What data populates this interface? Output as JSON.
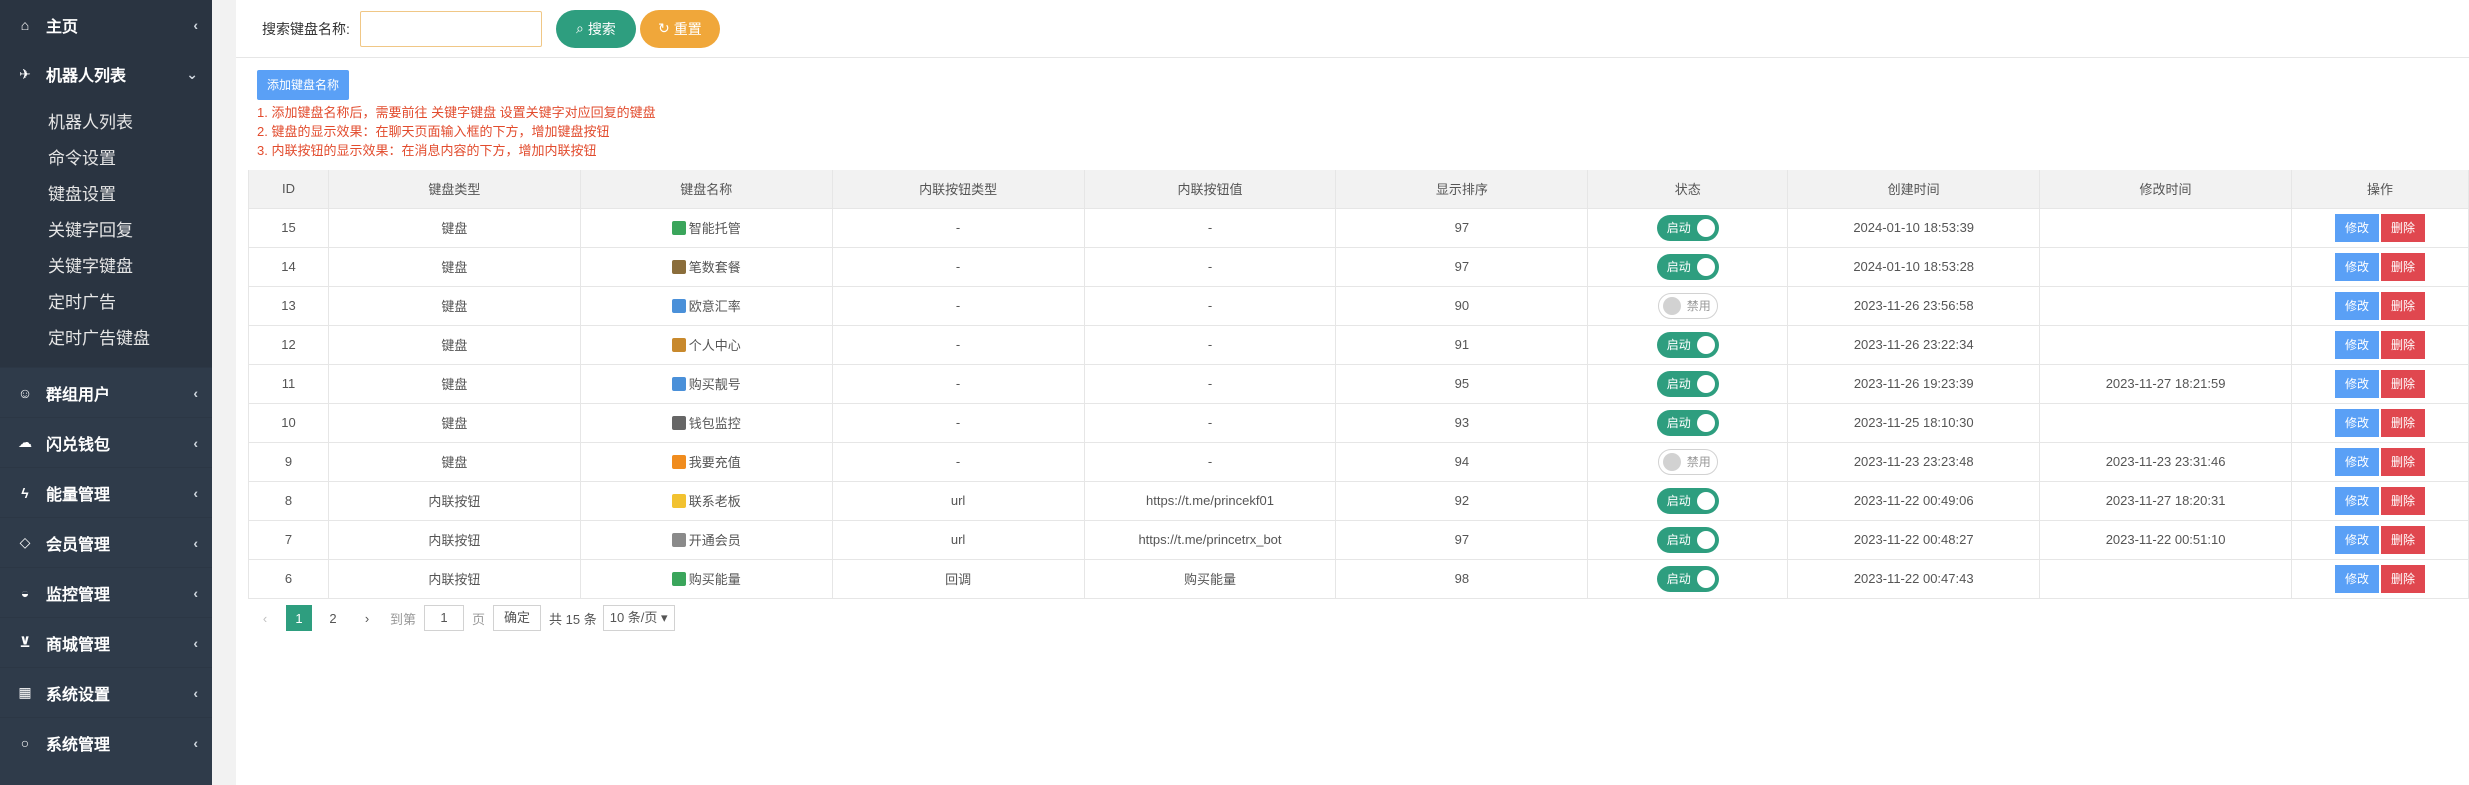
{
  "sidebar": {
    "home": {
      "label": "主页",
      "icon": "home-icon"
    },
    "robot_list": {
      "label": "机器人列表",
      "icon": "plane-icon"
    },
    "sub_items": [
      "机器人列表",
      "命令设置",
      "键盘设置",
      "关键字回复",
      "关键字键盘",
      "定时广告",
      "定时广告键盘"
    ],
    "items": [
      {
        "label": "群组用户",
        "icon": "users-icon"
      },
      {
        "label": "闪兑钱包",
        "icon": "cloud-icon"
      },
      {
        "label": "能量管理",
        "icon": "bolt-icon"
      },
      {
        "label": "会员管理",
        "icon": "diamond-icon"
      },
      {
        "label": "监控管理",
        "icon": "gauge-icon"
      },
      {
        "label": "商城管理",
        "icon": "cart-icon"
      },
      {
        "label": "系统设置",
        "icon": "windows-icon"
      },
      {
        "label": "系统管理",
        "icon": "circle-icon"
      }
    ]
  },
  "search": {
    "label": "搜索键盘名称:",
    "search_btn": "搜索",
    "reset_btn": "重置"
  },
  "actions": {
    "add_label": "添加键盘名称"
  },
  "tips": [
    "1. 添加键盘名称后，需要前往 关键字键盘 设置关键字对应回复的键盘",
    "2. 键盘的显示效果：在聊天页面输入框的下方，增加键盘按钮",
    "3. 内联按钮的显示效果：在消息内容的下方，增加内联按钮"
  ],
  "table": {
    "headers": [
      "ID",
      "键盘类型",
      "键盘名称",
      "内联按钮类型",
      "内联按钮值",
      "显示排序",
      "状态",
      "创建时间",
      "修改时间",
      "操作"
    ],
    "rows": [
      {
        "id": "15",
        "type": "键盘",
        "name": "智能托管",
        "icon_color": "#3aa55b",
        "btn_type": "-",
        "btn_value": "-",
        "sort": "97",
        "status": "启动",
        "enabled": true,
        "created": "2024-01-10 18:53:39",
        "modified": ""
      },
      {
        "id": "14",
        "type": "键盘",
        "name": "笔数套餐",
        "icon_color": "#8a6d3b",
        "btn_type": "-",
        "btn_value": "-",
        "sort": "97",
        "status": "启动",
        "enabled": true,
        "created": "2024-01-10 18:53:28",
        "modified": ""
      },
      {
        "id": "13",
        "type": "键盘",
        "name": "欧意汇率",
        "icon_color": "#4a90d9",
        "btn_type": "-",
        "btn_value": "-",
        "sort": "90",
        "status": "禁用",
        "enabled": false,
        "created": "2023-11-26 23:56:58",
        "modified": ""
      },
      {
        "id": "12",
        "type": "键盘",
        "name": "个人中心",
        "icon_color": "#c8892d",
        "btn_type": "-",
        "btn_value": "-",
        "sort": "91",
        "status": "启动",
        "enabled": true,
        "created": "2023-11-26 23:22:34",
        "modified": ""
      },
      {
        "id": "11",
        "type": "键盘",
        "name": "购买靓号",
        "icon_color": "#4a90d9",
        "btn_type": "-",
        "btn_value": "-",
        "sort": "95",
        "status": "启动",
        "enabled": true,
        "created": "2023-11-26 19:23:39",
        "modified": "2023-11-27 18:21:59"
      },
      {
        "id": "10",
        "type": "键盘",
        "name": "钱包监控",
        "icon_color": "#666666",
        "btn_type": "-",
        "btn_value": "-",
        "sort": "93",
        "status": "启动",
        "enabled": true,
        "created": "2023-11-25 18:10:30",
        "modified": ""
      },
      {
        "id": "9",
        "type": "键盘",
        "name": "我要充值",
        "icon_color": "#f08c1e",
        "btn_type": "-",
        "btn_value": "-",
        "sort": "94",
        "status": "禁用",
        "enabled": false,
        "created": "2023-11-23 23:23:48",
        "modified": "2023-11-23 23:31:46"
      },
      {
        "id": "8",
        "type": "内联按钮",
        "name": "联系老板",
        "icon_color": "#f2c230",
        "btn_type": "url",
        "btn_value": "https://t.me/princekf01",
        "sort": "92",
        "status": "启动",
        "enabled": true,
        "created": "2023-11-22 00:49:06",
        "modified": "2023-11-27 18:20:31"
      },
      {
        "id": "7",
        "type": "内联按钮",
        "name": "开通会员",
        "icon_color": "#8a8a8a",
        "btn_type": "url",
        "btn_value": "https://t.me/princetrx_bot",
        "sort": "97",
        "status": "启动",
        "enabled": true,
        "created": "2023-11-22 00:48:27",
        "modified": "2023-11-22 00:51:10"
      },
      {
        "id": "6",
        "type": "内联按钮",
        "name": "购买能量",
        "icon_color": "#3aa55b",
        "btn_type": "回调",
        "btn_value": "购买能量",
        "sort": "98",
        "status": "启动",
        "enabled": true,
        "created": "2023-11-22 00:47:43",
        "modified": ""
      }
    ],
    "edit_label": "修改",
    "delete_label": "删除"
  },
  "pager": {
    "pages": [
      "1",
      "2"
    ],
    "current": "1",
    "goto_label": "到第",
    "goto_value": "1",
    "page_unit": "页",
    "confirm": "确定",
    "total": "共 15 条",
    "per_page": "10 条/页"
  },
  "colors": {
    "accent": "#2e9e7f",
    "warning": "#f0a73a",
    "primary": "#5aa0f6",
    "danger": "#e0474f",
    "sidebar": "#2f3b4a"
  }
}
